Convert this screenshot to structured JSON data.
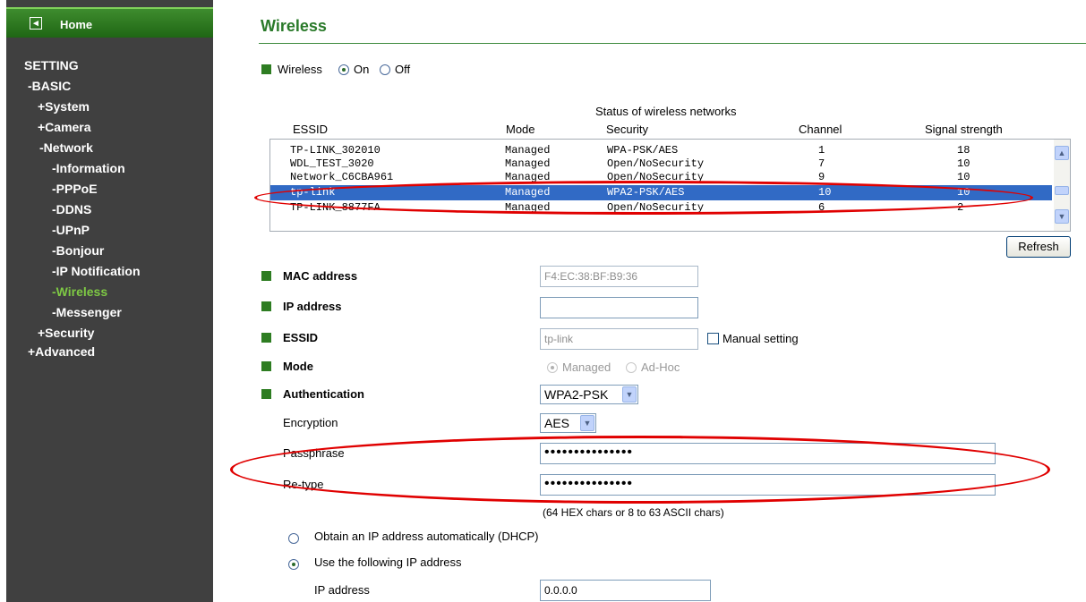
{
  "sidebar": {
    "home": "Home",
    "items": [
      {
        "label": "SETTING"
      },
      {
        "label": "-BASIC"
      },
      {
        "label": "+System"
      },
      {
        "label": "+Camera"
      },
      {
        "label": "-Network"
      },
      {
        "label": "-Information"
      },
      {
        "label": "-PPPoE"
      },
      {
        "label": "-DDNS"
      },
      {
        "label": "-UPnP"
      },
      {
        "label": "-Bonjour"
      },
      {
        "label": "-IP Notification"
      },
      {
        "label": "-Wireless"
      },
      {
        "label": "-Messenger"
      },
      {
        "label": "+Security"
      },
      {
        "label": "+Advanced"
      }
    ],
    "active_color": "#7ec944"
  },
  "page": {
    "title": "Wireless",
    "wireless": {
      "label": "Wireless",
      "on": "On",
      "off": "Off",
      "selected": "On"
    }
  },
  "networks": {
    "caption": "Status of wireless networks",
    "headers": [
      "ESSID",
      "Mode",
      "Security",
      "Channel",
      "Signal strength"
    ],
    "rows": [
      {
        "essid": "TP-LINK_302010",
        "mode": "Managed",
        "security": "WPA-PSK/AES",
        "channel": "1",
        "signal": "18"
      },
      {
        "essid": "WDL_TEST_3020",
        "mode": "Managed",
        "security": "Open/NoSecurity",
        "channel": "7",
        "signal": "10"
      },
      {
        "essid": "Network_C6CBA961",
        "mode": "Managed",
        "security": "Open/NoSecurity",
        "channel": "9",
        "signal": "10"
      },
      {
        "essid": "tp-link",
        "mode": "Managed",
        "security": "WPA2-PSK/AES",
        "channel": "10",
        "signal": "10"
      },
      {
        "essid": "TP-LINK_8877FA",
        "mode": "Managed",
        "security": "Open/NoSecurity",
        "channel": "6",
        "signal": "2"
      }
    ],
    "selected_index": 3,
    "refresh": "Refresh"
  },
  "form": {
    "mac": {
      "label": "MAC address",
      "value": "F4:EC:38:BF:B9:36"
    },
    "ip": {
      "label": "IP address",
      "value": ""
    },
    "essid": {
      "label": "ESSID",
      "value": "tp-link",
      "manual": "Manual setting"
    },
    "mode": {
      "label": "Mode",
      "managed": "Managed",
      "adhoc": "Ad-Hoc",
      "selected": "Managed"
    },
    "auth": {
      "label": "Authentication",
      "value": "WPA2-PSK"
    },
    "encryption": {
      "label": "Encryption",
      "value": "AES"
    },
    "passphrase": {
      "label": "Passphrase",
      "value": "•••••••••••••••"
    },
    "retype": {
      "label": "Re-type",
      "value": "•••••••••••••••"
    },
    "hint": "(64 HEX chars or 8 to 63 ASCII chars)",
    "dhcp": "Obtain an IP address automatically (DHCP)",
    "static": "Use the following IP address",
    "static_selected": true,
    "static_ip": {
      "label": "IP address",
      "value": "0.0.0.0"
    }
  },
  "colors": {
    "sidebar_bg": "#404040",
    "accent_green": "#2a7a2a",
    "selection_blue": "#316ac5",
    "annotation_red": "#e00000"
  }
}
